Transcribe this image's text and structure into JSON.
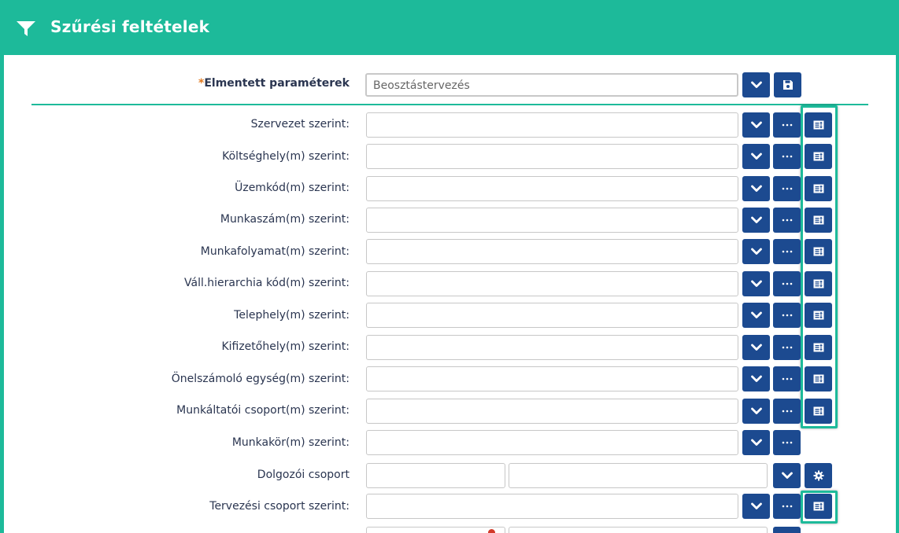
{
  "header": {
    "title": "Szűrési feltételek"
  },
  "saved_params": {
    "required_mark": "*",
    "label": "Elmentett paraméterek",
    "value": "Beosztástervezés"
  },
  "rows": [
    {
      "label": "Szervezet szerint:"
    },
    {
      "label": "Költséghely(m) szerint:"
    },
    {
      "label": "Üzemkód(m) szerint:"
    },
    {
      "label": "Munkaszám(m) szerint:"
    },
    {
      "label": "Munkafolyamat(m) szerint:"
    },
    {
      "label": "Váll.hierarchia kód(m) szerint:"
    },
    {
      "label": "Telephely(m) szerint:"
    },
    {
      "label": "Kifizetőhely(m) szerint:"
    },
    {
      "label": "Önelszámoló egység(m) szerint:"
    },
    {
      "label": "Munkáltatói csoport(m) szerint:"
    },
    {
      "label": "Munkakör(m) szerint:"
    },
    {
      "label": "Dolgozói csoport"
    },
    {
      "label": "Tervezési csoport szerint:"
    }
  ],
  "icons": {
    "dropdown": "chevron-down-icon",
    "more": "ellipsis-icon",
    "list": "list-detail-icon",
    "save": "floppy-icon",
    "settings": "gear-icon",
    "filter": "filter-icon"
  },
  "colors": {
    "accent": "#1dba9a",
    "button": "#1c4a90",
    "required": "#e0791f"
  }
}
